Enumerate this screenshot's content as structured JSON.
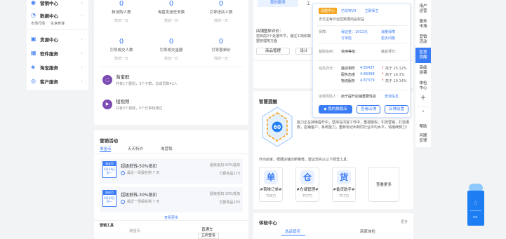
{
  "sidebar": {
    "items": [
      {
        "label": "营销中心",
        "icon": "megaphone-icon"
      },
      {
        "label": "数据中心",
        "icon": "chart-icon"
      },
      {
        "label": "货源中心",
        "icon": "box-icon"
      },
      {
        "label": "软件服务",
        "icon": "grid-icon"
      },
      {
        "label": "淘宝服务",
        "icon": "taobao-icon"
      },
      {
        "label": "客户服务",
        "icon": "headset-icon"
      }
    ],
    "sub_items": [
      "市场行情",
      "生意参谋"
    ]
  },
  "stats": [
    {
      "value": "0",
      "label": "新加购人数",
      "compare": "较前一日"
    },
    {
      "value": "0",
      "label": "询盘发送任务数",
      "compare": "较前一日"
    },
    {
      "value": "0",
      "label": "引导进店人数",
      "compare": "较前一日"
    },
    {
      "value": "0",
      "label": "引导成交人数",
      "compare": "较前一日"
    },
    {
      "value": "0",
      "label": "引导成交金额",
      "compare": "较前一日"
    },
    {
      "value": "0",
      "label": "引导客单价",
      "compare": "较前一日"
    }
  ],
  "groups": [
    {
      "title": "淘宝群",
      "desc": "共有1个群组，3个子群，总成员数41人"
    },
    {
      "title": "短视频",
      "desc": "共有5个视频，5个已审核通过"
    }
  ],
  "marketing": {
    "title": "营销活动",
    "tabs": [
      "淘金币",
      "天天特价",
      "淘营销"
    ],
    "campaigns": [
      {
        "tag_head": "淘金币",
        "tag_body": "6月24日前一",
        "title": "超级抵钱-50%抵扣",
        "meta": "最近一场报名剩 7 天",
        "right_top": "超级抵扣-50%抵扣",
        "right_bottom": "已报商品173"
      },
      {
        "tag_head": "淘金币",
        "tag_body": "6月24日前一",
        "title": "超级抵钱-30%抵扣",
        "meta": "最近一场报名剩 7 天",
        "right_top": "超级抵扣-30%抵扣",
        "right_bottom": "已报商品103"
      }
    ],
    "more": "查看更多",
    "tools_title": "营销工具",
    "tools_left": "淘金币",
    "tools_right": "直通车",
    "tools_btn": "立即查看"
  },
  "middle": {
    "tabs": [
      "我的服务",
      "工"
    ],
    "store_section": "店铺整体评价：",
    "store_text": "您目前2个处置环节，通过工商和数据管理等方面",
    "btn_goods": "商品管理",
    "btn_settle": "设计",
    "smart_title": "智慧提醒",
    "hex_value": "60",
    "smart_text": "能力正在持续提升中，坚持在内容工作中，重视版权，引流营销，打造爆款，店铺客户，系统能力，重新标记出到同行业平均水平，请继续努力！",
    "tools_hint": "作为店家，根据店铺诊断推荐，建议您先以以下经营工具：",
    "tools": [
      {
        "glyph": "单",
        "name": "#首推订单#",
        "count": "758万"
      },
      {
        "glyph": "仓",
        "name": "#仓储管理#",
        "count": "757万"
      },
      {
        "glyph": "货",
        "name": "#备货助手#",
        "count": "757万"
      }
    ],
    "tools_more": "查看更多",
    "health_title": "体检中心",
    "health_more": "更多",
    "health_tabs": [
      "选品管控",
      "商家体检"
    ]
  },
  "popup": {
    "badge": "设施中心",
    "level": "已授权V3",
    "upgrade": "立即保卫",
    "desc": "支付宝每日运营数据商品权益",
    "asset_label": "保障：",
    "asset_value": "保证金：1911元",
    "asset_link": "海量保障",
    "order_link": "订单险",
    "more_link": "更多问题",
    "credit_label": "基础信用：",
    "credit_value": "信用等级：",
    "credit_right": "综合评分：",
    "dsr_label": "动态评分：",
    "dsr": [
      {
        "name": "描述相符",
        "score": "4.85437",
        "trend": "高于 25.12%"
      },
      {
        "name": "服务态度",
        "score": "4.86468",
        "trend": "高于 16.3%"
      },
      {
        "name": "物流服务",
        "score": "4.87379",
        "trend": "高于 19.14%"
      }
    ],
    "risk_label": "违规风险人：",
    "risk_value": "用于提升店铺重要性扣",
    "risk_link": "查询信息",
    "btn_shop": "我的旗舰店",
    "btn_store": "查看店铺",
    "btn_settings": "店铺设置"
  },
  "right_sidebar": {
    "items": [
      "用户运营",
      "服务市场",
      "营销活动",
      "智慧提醒",
      "高级逆袭",
      "体检中心"
    ],
    "active_index": 3,
    "help": "帮助",
    "faq": "问题反馈"
  },
  "colors": {
    "accent": "#3a7bf6",
    "danger": "#f0483e",
    "badge": "#f5a623"
  }
}
